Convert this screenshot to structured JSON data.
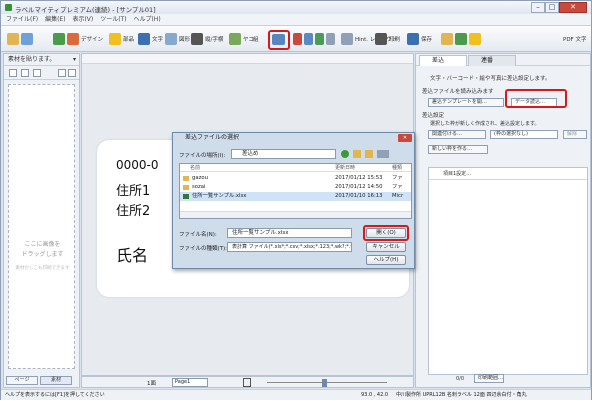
{
  "window": {
    "title": "ラベルマイティプレミアム(連続) - [サンプル01]",
    "controls": {
      "minimize": "–",
      "maximize": "□",
      "close": "✕"
    }
  },
  "menu": [
    "ファイル(F)",
    "編集(E)",
    "表示(V)",
    "ツール(T)",
    "ヘルプ(H)"
  ],
  "toolbar": {
    "design": "デザイン",
    "parts": "部品",
    "text": "文字",
    "shape": "図形",
    "qr": "縦/字横",
    "frame": "ヤコ",
    "chart": "組",
    "layout_btn": "Hint. レイアウト",
    "print": "印刷",
    "save": "保存",
    "pdf": "PDF 文字"
  },
  "left_panel": {
    "header": "素材を貼ります。",
    "drop_text": [
      "ここに画像を",
      "ドラッグします"
    ],
    "drop_sub": "素材かしこも印刷できます",
    "page_btn": "ページ",
    "material_btn": "素材"
  },
  "label": {
    "zip": "0000-0",
    "address1": "住所1",
    "address2": "住所2",
    "name": "氏名"
  },
  "canvas_status": {
    "page_label": "1面",
    "page_value": "Page1"
  },
  "right_panel": {
    "tab1": "差込",
    "tab2": "連番",
    "info": "文字・バーコード・絵や写真に差込設定します。",
    "section1": "差込ファイルを読み込みます",
    "template_btn": "差込テンプレートを開…",
    "data_read_btn": "データ読込…",
    "section2": "差込設定",
    "set_text": "選択した枠が新しく作成され、差込設定します。",
    "assign_btn": "関連付ける…",
    "new_frame_label": "(枠の選択なし)",
    "release_btn": "解除",
    "new_frame_btn": "新しい枠を作る…",
    "grid_toolbar": "項目1設定…",
    "page_count": "0/0",
    "print_range": "印刷範囲…"
  },
  "status_bar": {
    "help": "ヘルプを表示するには[F1]を押してください",
    "coords": "93.0 , 42.0",
    "paper": "中川製作所 UPRL12B 名刺ラベル 12面 四辺余白付・角丸"
  },
  "dialog": {
    "title": "差込ファイルの選択",
    "lookin_label": "ファイルの場所(I):",
    "lookin_value": "差込め",
    "columns": [
      "名前",
      "更新日時",
      "種類"
    ],
    "files": [
      {
        "name": "gazou",
        "date": "2017/01/12 15:53",
        "type": "ファ"
      },
      {
        "name": "sozai",
        "date": "2017/01/12 14:50",
        "type": "ファ"
      },
      {
        "name": "住所一覧サンプル.xlsx",
        "date": "2017/01/10 16:13",
        "type": "Micr"
      }
    ],
    "filename_label": "ファイル名(N):",
    "filename_value": "住所一覧サンプル.xlsx",
    "filetype_label": "ファイルの種類(T):",
    "filetype_value": "表計算 ファイル(*.xls*;*.csv;*.xlsx;*.123;*.wk?;*.wq1)",
    "open_btn": "開く(O)",
    "cancel_btn": "キャンセル",
    "help_btn": "ヘルプ(H)"
  },
  "colors": {
    "highlight": "#d41a1a",
    "accent": "#3a6fb0"
  }
}
